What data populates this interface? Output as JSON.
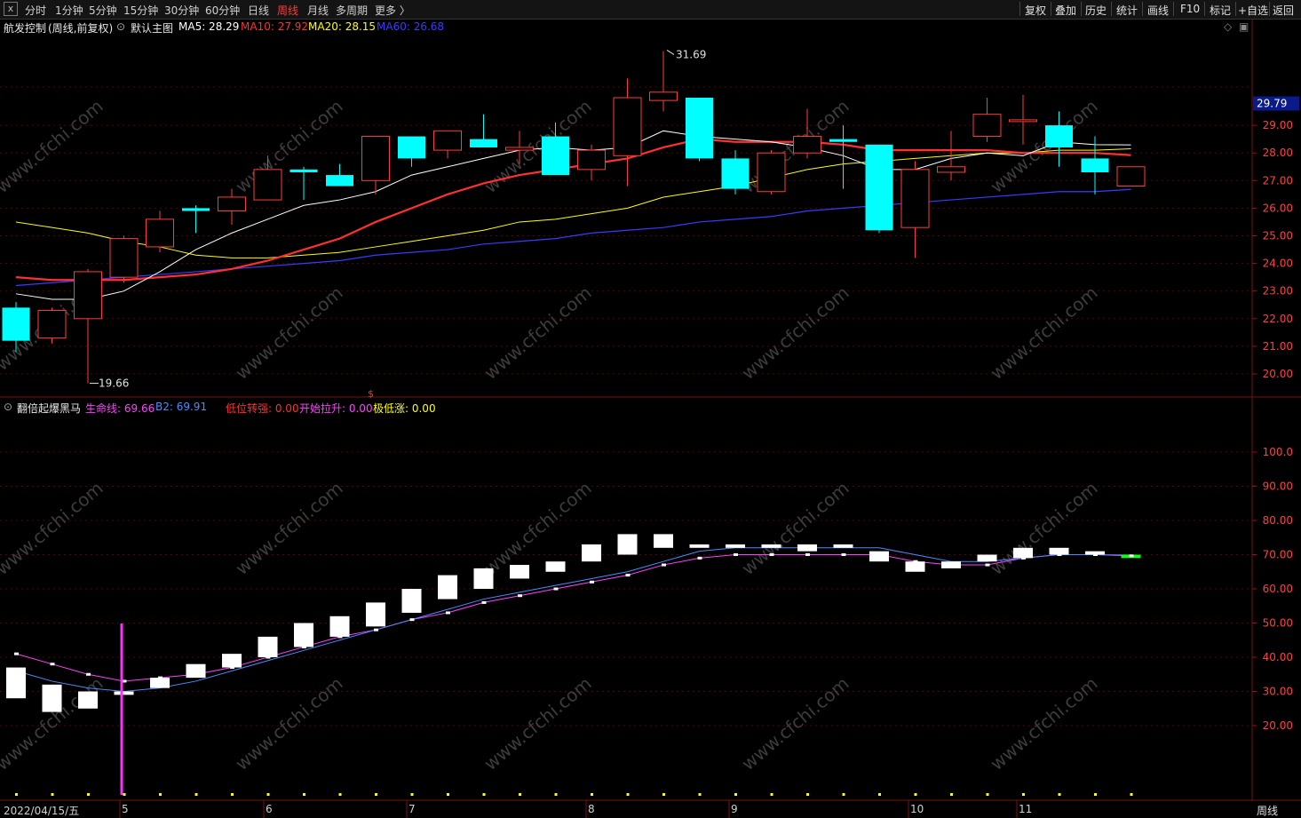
{
  "toolbar": {
    "close": "x",
    "periods": [
      "分时",
      "1分钟",
      "5分钟",
      "15分钟",
      "30分钟",
      "60分钟",
      "日线",
      "周线",
      "月线",
      "多周期",
      "更多 〉"
    ],
    "active_period": "周线",
    "right_buttons": [
      "复权",
      "叠加",
      "历史",
      "统计",
      "画线",
      "F10",
      "标记",
      "+自选",
      "返回"
    ]
  },
  "main_header": {
    "stock": "航发控制",
    "mode": "(周线,前复权)",
    "template": "默认主图",
    "ma5": {
      "label": "MA5: 28.29",
      "color": "#ffffff"
    },
    "ma10": {
      "label": "MA10: 27.92",
      "color": "#ff3030"
    },
    "ma20": {
      "label": "MA20: 28.15",
      "color": "#ffff00"
    },
    "ma60": {
      "label": "MA60: 26.68",
      "color": "#3a3aff"
    }
  },
  "price_axis": {
    "ticks": [
      "29.00",
      "28.00",
      "27.00",
      "26.00",
      "25.00",
      "24.00",
      "23.00",
      "22.00",
      "21.00",
      "20.00"
    ],
    "current": "29.79"
  },
  "annotations": {
    "high": "31.69",
    "low": "19.66",
    "dividend_mark": "$"
  },
  "indicator_header": {
    "name": "翻倍起爆黑马",
    "life": {
      "label": "生命线: 69.66",
      "color": "#ff40ff"
    },
    "b2": {
      "label": "B2: 69.91",
      "color": "#4a8cff"
    },
    "low_strong": {
      "label": "低位转强: 0.00",
      "color": "#ff3030"
    },
    "start_pull": {
      "label": "开始拉升: 0.00",
      "color": "#ff40ff"
    },
    "extreme_low": {
      "label": "极低涨: 0.00",
      "color": "#ffff00"
    }
  },
  "indicator_axis": {
    "ticks": [
      "100.0",
      "90.00",
      "80.00",
      "70.00",
      "60.00",
      "50.00",
      "40.00",
      "30.00",
      "20.00"
    ]
  },
  "time_axis": {
    "labels": [
      "2022/04/15/五",
      "5",
      "6",
      "7",
      "8",
      "9",
      "10",
      "11"
    ],
    "period": "周线"
  },
  "watermark": "www.cfchi.com",
  "colors": {
    "up": "#ff3b3b",
    "down": "#00ffff",
    "ind_up": "#ffffff",
    "ind_down": "#11ff11",
    "grid": "#5a0000"
  },
  "chart_data": [
    {
      "type": "candlestick",
      "candles": [
        {
          "o": 22.4,
          "h": 22.6,
          "l": 20.8,
          "c": 21.2
        },
        {
          "o": 21.3,
          "h": 22.4,
          "l": 21.1,
          "c": 22.3
        },
        {
          "o": 22.0,
          "h": 23.8,
          "l": 19.66,
          "c": 23.7
        },
        {
          "o": 23.5,
          "h": 25.0,
          "l": 23.3,
          "c": 24.9
        },
        {
          "o": 24.6,
          "h": 25.9,
          "l": 24.4,
          "c": 25.6
        },
        {
          "o": 26.0,
          "h": 26.1,
          "l": 25.1,
          "c": 25.9
        },
        {
          "o": 25.9,
          "h": 26.7,
          "l": 25.4,
          "c": 26.4
        },
        {
          "o": 26.3,
          "h": 27.9,
          "l": 26.3,
          "c": 27.4
        },
        {
          "o": 27.4,
          "h": 27.5,
          "l": 26.3,
          "c": 27.3
        },
        {
          "o": 27.2,
          "h": 27.6,
          "l": 26.8,
          "c": 26.8
        },
        {
          "o": 27.0,
          "h": 28.6,
          "l": 26.5,
          "c": 28.6
        },
        {
          "o": 28.6,
          "h": 28.6,
          "l": 27.5,
          "c": 27.8
        },
        {
          "o": 28.1,
          "h": 28.8,
          "l": 27.8,
          "c": 28.8
        },
        {
          "o": 28.5,
          "h": 29.4,
          "l": 28.3,
          "c": 28.2
        },
        {
          "o": 28.1,
          "h": 28.8,
          "l": 27.6,
          "c": 28.2
        },
        {
          "o": 28.6,
          "h": 29.1,
          "l": 27.4,
          "c": 27.2
        },
        {
          "o": 27.4,
          "h": 28.3,
          "l": 27.0,
          "c": 28.1
        },
        {
          "o": 27.9,
          "h": 30.7,
          "l": 26.8,
          "c": 30.0
        },
        {
          "o": 29.9,
          "h": 31.69,
          "l": 29.5,
          "c": 30.2
        },
        {
          "o": 30.0,
          "h": 30.0,
          "l": 27.7,
          "c": 27.8
        },
        {
          "o": 27.8,
          "h": 28.1,
          "l": 26.5,
          "c": 26.7
        },
        {
          "o": 26.6,
          "h": 28.1,
          "l": 26.5,
          "c": 28.0
        },
        {
          "o": 28.0,
          "h": 29.6,
          "l": 27.8,
          "c": 28.6
        },
        {
          "o": 28.5,
          "h": 29.0,
          "l": 26.7,
          "c": 28.4
        },
        {
          "o": 28.3,
          "h": 28.3,
          "l": 25.1,
          "c": 25.2
        },
        {
          "o": 25.3,
          "h": 27.7,
          "l": 24.2,
          "c": 27.4
        },
        {
          "o": 27.3,
          "h": 28.8,
          "l": 27.0,
          "c": 27.5
        },
        {
          "o": 28.6,
          "h": 30.0,
          "l": 28.4,
          "c": 29.4
        },
        {
          "o": 29.2,
          "h": 30.1,
          "l": 28.3,
          "c": 29.2
        },
        {
          "o": 29.0,
          "h": 29.5,
          "l": 27.5,
          "c": 28.2
        },
        {
          "o": 27.8,
          "h": 28.6,
          "l": 26.5,
          "c": 27.3
        },
        {
          "o": 26.8,
          "h": 27.5,
          "l": 26.8,
          "c": 27.5
        }
      ],
      "ma5": [
        22.9,
        22.7,
        22.7,
        23.0,
        23.7,
        24.5,
        25.1,
        25.6,
        26.1,
        26.3,
        26.6,
        27.2,
        27.5,
        27.8,
        28.1,
        28.2,
        28.1,
        28.2,
        28.8,
        28.6,
        28.5,
        28.4,
        28.2,
        27.9,
        27.4,
        27.4,
        27.8,
        28.0,
        27.9,
        28.4,
        28.3,
        28.29
      ],
      "ma10": [
        23.5,
        23.4,
        23.4,
        23.4,
        23.5,
        23.6,
        23.8,
        24.1,
        24.5,
        24.9,
        25.5,
        26.0,
        26.5,
        26.9,
        27.2,
        27.4,
        27.6,
        27.8,
        28.2,
        28.5,
        28.4,
        28.4,
        28.4,
        28.3,
        28.1,
        28.1,
        28.1,
        28.1,
        28.0,
        28.0,
        28.0,
        27.92
      ],
      "ma20": [
        25.5,
        25.3,
        25.1,
        24.8,
        24.6,
        24.3,
        24.2,
        24.2,
        24.3,
        24.4,
        24.6,
        24.8,
        25.0,
        25.2,
        25.5,
        25.6,
        25.8,
        26.0,
        26.4,
        26.6,
        26.8,
        27.1,
        27.4,
        27.6,
        27.7,
        27.8,
        27.9,
        28.0,
        28.0,
        28.1,
        28.1,
        28.15
      ],
      "ma60": [
        23.2,
        23.3,
        23.4,
        23.5,
        23.6,
        23.7,
        23.8,
        23.9,
        24.0,
        24.1,
        24.3,
        24.4,
        24.5,
        24.7,
        24.8,
        24.9,
        25.1,
        25.2,
        25.3,
        25.5,
        25.6,
        25.7,
        25.9,
        26.0,
        26.1,
        26.2,
        26.3,
        26.4,
        26.5,
        26.6,
        26.6,
        26.68
      ],
      "ylim": [
        19.4,
        32.0
      ]
    },
    {
      "type": "bar",
      "blocks": [
        {
          "o": 28,
          "c": 37
        },
        {
          "o": 24,
          "c": 32
        },
        {
          "o": 25,
          "c": 30
        },
        {
          "o": 29,
          "c": 30
        },
        {
          "o": 31,
          "c": 34
        },
        {
          "o": 34,
          "c": 38
        },
        {
          "o": 37,
          "c": 41
        },
        {
          "o": 40,
          "c": 46
        },
        {
          "o": 43,
          "c": 50
        },
        {
          "o": 46,
          "c": 52
        },
        {
          "o": 49,
          "c": 56
        },
        {
          "o": 53,
          "c": 60
        },
        {
          "o": 57,
          "c": 64
        },
        {
          "o": 60,
          "c": 66
        },
        {
          "o": 63,
          "c": 67
        },
        {
          "o": 65,
          "c": 68
        },
        {
          "o": 68,
          "c": 73
        },
        {
          "o": 70,
          "c": 76
        },
        {
          "o": 72,
          "c": 76
        },
        {
          "o": 72,
          "c": 73
        },
        {
          "o": 72,
          "c": 73
        },
        {
          "o": 72,
          "c": 73
        },
        {
          "o": 71,
          "c": 73
        },
        {
          "o": 72,
          "c": 73
        },
        {
          "o": 68,
          "c": 71
        },
        {
          "o": 65,
          "c": 68
        },
        {
          "o": 66,
          "c": 68
        },
        {
          "o": 68,
          "c": 70
        },
        {
          "o": 69,
          "c": 72
        },
        {
          "o": 70,
          "c": 72
        },
        {
          "o": 70,
          "c": 71
        },
        {
          "o": 70,
          "c": 69
        }
      ],
      "life_line": [
        41,
        38,
        35,
        33,
        34,
        35,
        37,
        40,
        43,
        46,
        48,
        51,
        53,
        56,
        58,
        60,
        62,
        64,
        67,
        69,
        70,
        70,
        70,
        70,
        70,
        68,
        67,
        67,
        69,
        70,
        70,
        69.66
      ],
      "b2_line": [
        36,
        33,
        31,
        30,
        31,
        33,
        36,
        39,
        42,
        45,
        48,
        51,
        54,
        57,
        59,
        61,
        63,
        65,
        68,
        71,
        72,
        72,
        72,
        72,
        72,
        70,
        68,
        68,
        69,
        70,
        70,
        69.91
      ],
      "ylim": [
        5,
        112
      ]
    }
  ]
}
